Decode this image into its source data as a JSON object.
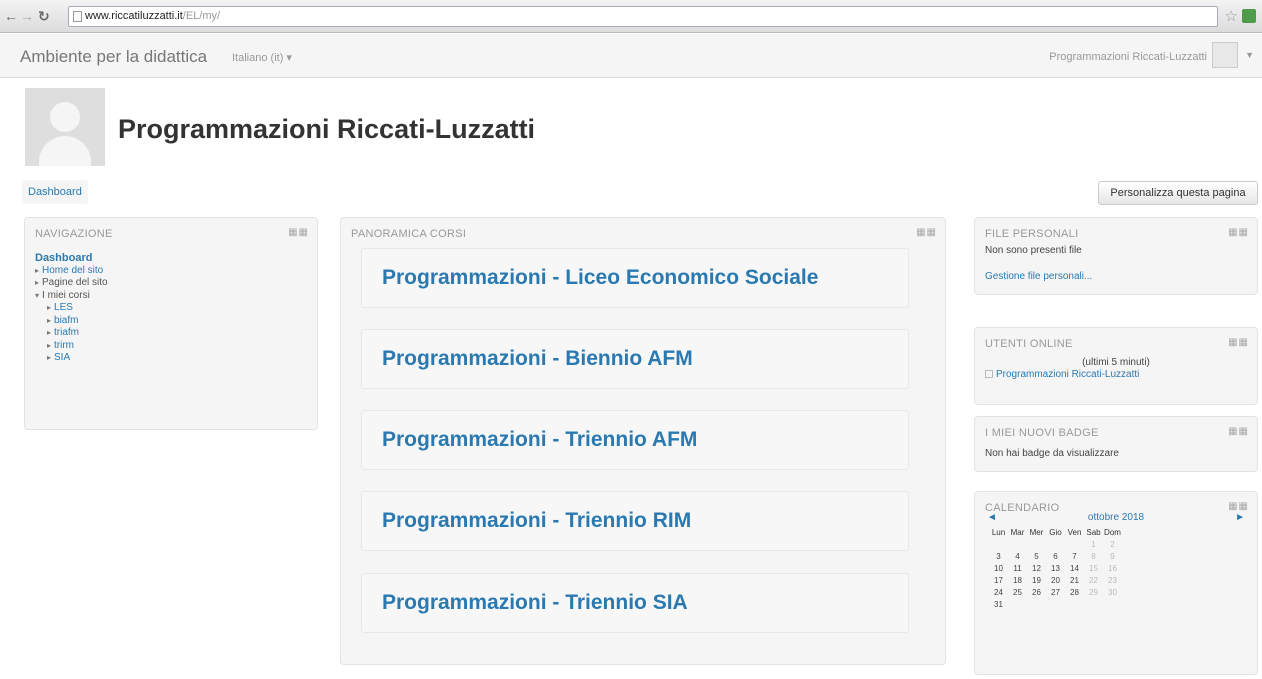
{
  "browser": {
    "back_icon": "back-arrow-icon",
    "forward_icon": "forward-arrow-icon",
    "reload_icon": "reload-icon",
    "url_host": "www.riccatiluzzatti.it",
    "url_path": "/EL/my/"
  },
  "navbar": {
    "brand": "Ambiente per la didattica",
    "language": "Italiano (it) ▾",
    "user_name": "Programmazioni Riccati-Luzzatti"
  },
  "header": {
    "title": "Programmazioni Riccati-Luzzatti",
    "breadcrumb": "Dashboard",
    "customize_button": "Personalizza questa pagina"
  },
  "navigation": {
    "title": "NAVIGAZIONE",
    "dashboard": "Dashboard",
    "items": [
      {
        "label": "Home del sito",
        "marker": "▸"
      },
      {
        "label": "Pagine del sito",
        "marker": "▸"
      },
      {
        "label": "I miei corsi",
        "marker": "▾"
      }
    ],
    "courses": [
      "LES",
      "biafm",
      "triafm",
      "trirm",
      "SIA"
    ]
  },
  "course_overview": {
    "title": "PANORAMICA CORSI",
    "courses": [
      "Programmazioni - Liceo Economico Sociale",
      "Programmazioni - Biennio AFM",
      "Programmazioni - Triennio AFM",
      "Programmazioni - Triennio RIM",
      "Programmazioni - Triennio SIA"
    ]
  },
  "private_files": {
    "title": "FILE PERSONALI",
    "empty_text": "Non sono presenti file",
    "manage_link": "Gestione file personali..."
  },
  "online_users": {
    "title": "UTENTI ONLINE",
    "period": "(ultimi 5 minuti)",
    "user": "Programmazioni Riccati-Luzzatti"
  },
  "badges": {
    "title": "I MIEI NUOVI BADGE",
    "empty_text": "Non hai badge da visualizzare"
  },
  "calendar": {
    "title": "CALENDARIO",
    "month": "ottobre 2018",
    "prev": "◄",
    "next": "►",
    "weekdays": [
      "Lun",
      "Mar",
      "Mer",
      "Gio",
      "Ven",
      "Sab",
      "Dom"
    ],
    "weeks": [
      [
        "",
        "",
        "",
        "",
        "",
        "1",
        "2"
      ],
      [
        "3",
        "4",
        "5",
        "6",
        "7",
        "8",
        "9"
      ],
      [
        "10",
        "11",
        "12",
        "13",
        "14",
        "15",
        "16"
      ],
      [
        "17",
        "18",
        "19",
        "20",
        "21",
        "22",
        "23"
      ],
      [
        "24",
        "25",
        "26",
        "27",
        "28",
        "29",
        "30"
      ],
      [
        "31",
        "",
        "",
        "",
        "",
        "",
        ""
      ]
    ]
  },
  "block_controls_icon": "block-controls-icon"
}
